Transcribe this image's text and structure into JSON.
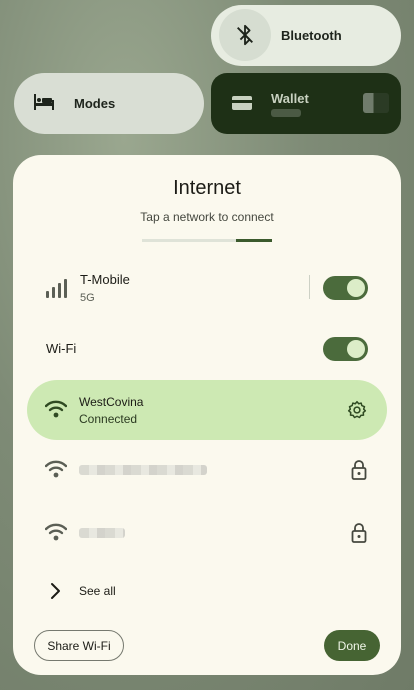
{
  "quick_tiles": {
    "bluetooth": {
      "label": "Bluetooth",
      "icon": "bluetooth-off-icon"
    },
    "modes": {
      "label": "Modes",
      "icon": "bed-icon"
    },
    "wallet": {
      "label": "Wallet",
      "icon": "wallet-icon"
    }
  },
  "dialog": {
    "title": "Internet",
    "subtitle": "Tap a network to connect",
    "progress_fraction": 0.28,
    "mobile": {
      "carrier": "T-Mobile",
      "technology": "5G",
      "enabled": true
    },
    "wifi": {
      "label": "Wi-Fi",
      "enabled": true
    },
    "networks": [
      {
        "name": "WestCovina",
        "status": "Connected",
        "icon": "wifi-icon",
        "action_icon": "settings-gear-icon"
      },
      {
        "name": "",
        "status": "",
        "icon": "wifi-icon",
        "action_icon": "lock-icon"
      },
      {
        "name": "",
        "status": "",
        "icon": "wifi-icon",
        "action_icon": "lock-icon"
      }
    ],
    "see_all_label": "See all",
    "share_button": "Share Wi-Fi",
    "done_button": "Done"
  },
  "colors": {
    "accent": "#466433",
    "connected_bg": "#cde9b3",
    "dialog_bg": "#fbf9ee"
  }
}
